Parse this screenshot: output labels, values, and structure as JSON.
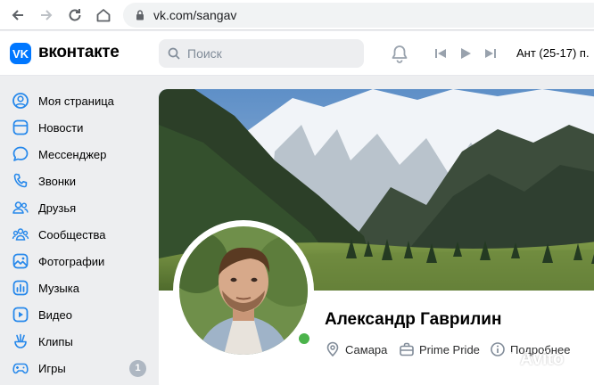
{
  "browser": {
    "url": "vk.com/sangav"
  },
  "header": {
    "logo_text": "вконтакте",
    "logo_mark": "VK",
    "search_placeholder": "Поиск",
    "now_playing": "Ант (25-17) п."
  },
  "sidebar": {
    "items": [
      {
        "label": "Моя страница",
        "icon": "user-circle-icon"
      },
      {
        "label": "Новости",
        "icon": "newsfeed-icon"
      },
      {
        "label": "Мессенджер",
        "icon": "message-icon"
      },
      {
        "label": "Звонки",
        "icon": "phone-icon"
      },
      {
        "label": "Друзья",
        "icon": "friends-icon"
      },
      {
        "label": "Сообщества",
        "icon": "communities-icon"
      },
      {
        "label": "Фотографии",
        "icon": "photo-icon"
      },
      {
        "label": "Музыка",
        "icon": "music-icon"
      },
      {
        "label": "Видео",
        "icon": "video-icon"
      },
      {
        "label": "Клипы",
        "icon": "clips-icon"
      },
      {
        "label": "Игры",
        "icon": "games-icon",
        "badge": "1"
      }
    ]
  },
  "profile": {
    "name": "Александр Гаврилин",
    "city": "Самара",
    "work": "Prime Pride",
    "more": "Подробнее",
    "online": true
  },
  "watermark": "Avito",
  "colors": {
    "accent": "#0077ff",
    "page_bg": "#edeef0",
    "online": "#4bb34b",
    "icon": "#2688eb"
  }
}
